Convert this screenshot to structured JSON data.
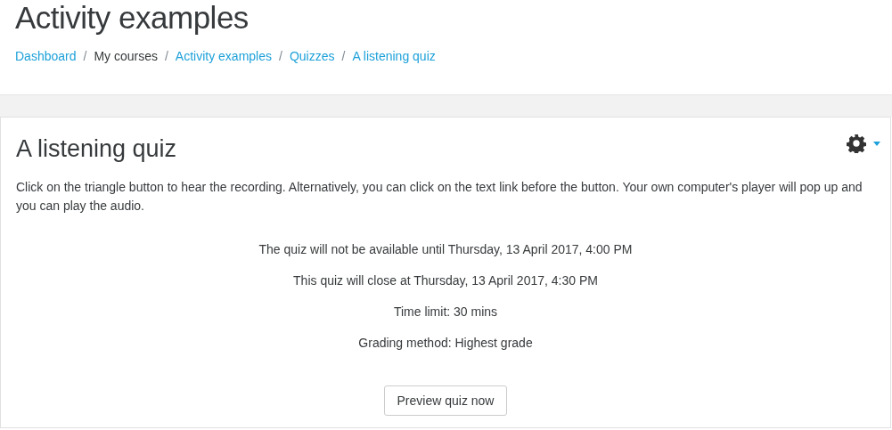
{
  "page_title": "Activity examples",
  "breadcrumb": [
    {
      "label": "Dashboard",
      "link": true
    },
    {
      "label": "My courses",
      "link": false
    },
    {
      "label": "Activity examples",
      "link": true
    },
    {
      "label": "Quizzes",
      "link": true
    },
    {
      "label": "A listening quiz",
      "link": true
    }
  ],
  "separator": "/",
  "activity": {
    "title": "A listening quiz",
    "intro": "Click on the triangle button to hear the recording. Alternatively, you can click on the text link before the button. Your own computer's player will pop up and you can play the audio.",
    "info": [
      "The quiz will not be available until Thursday, 13 April 2017, 4:00 PM",
      "This quiz will close at Thursday, 13 April 2017, 4:30 PM",
      "Time limit: 30 mins",
      "Grading method: Highest grade"
    ],
    "button": "Preview quiz now"
  }
}
